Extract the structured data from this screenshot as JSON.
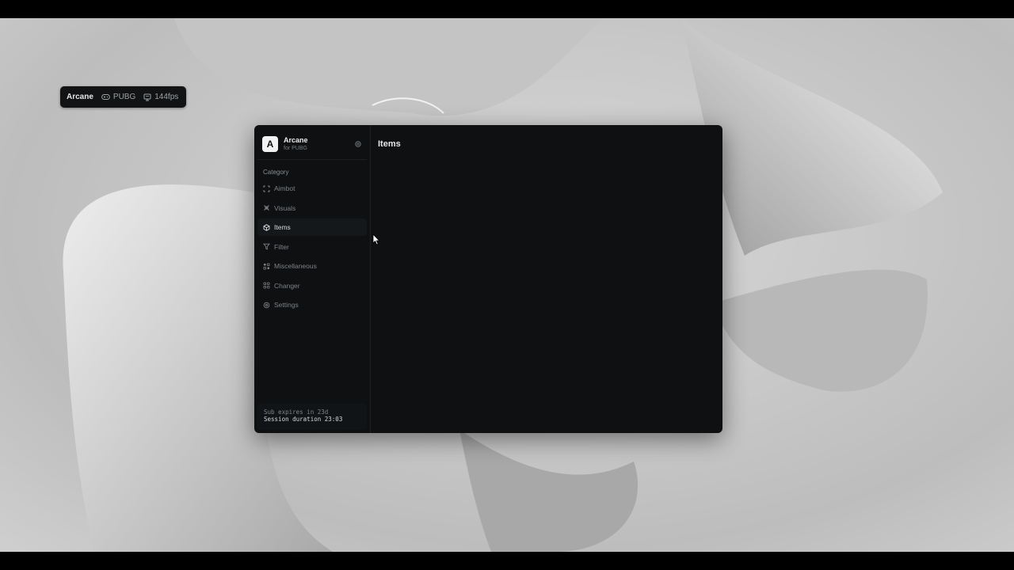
{
  "overlay": {
    "brand": "Arcane",
    "game": "PUBG",
    "fps": "144fps",
    "game_icon": "gamepad-icon",
    "fps_icon": "monitor-icon"
  },
  "app": {
    "logo_letter": "A",
    "name": "Arcane",
    "subtitle": "for PUBG",
    "settings_icon": "gear-icon"
  },
  "sidebar": {
    "category_label": "Category",
    "items": [
      {
        "label": "Aimbot",
        "icon": "crosshair-icon",
        "active": false
      },
      {
        "label": "Visuals",
        "icon": "eye-icon",
        "active": false
      },
      {
        "label": "Items",
        "icon": "box-icon",
        "active": true
      },
      {
        "label": "Filter",
        "icon": "filter-icon",
        "active": false
      },
      {
        "label": "Miscellaneous",
        "icon": "grid-icon",
        "active": false
      },
      {
        "label": "Changer",
        "icon": "apps-icon",
        "active": false
      },
      {
        "label": "Settings",
        "icon": "gear-icon",
        "active": false
      }
    ]
  },
  "footer": {
    "expires": "Sub expires in 23d",
    "session": "Session duration 23:03"
  },
  "content": {
    "title": "Items"
  },
  "colors": {
    "window_bg": "#0e1012",
    "active_item_bg": "#15181b",
    "text_primary": "#eaeaea",
    "text_muted": "#7d8287"
  }
}
